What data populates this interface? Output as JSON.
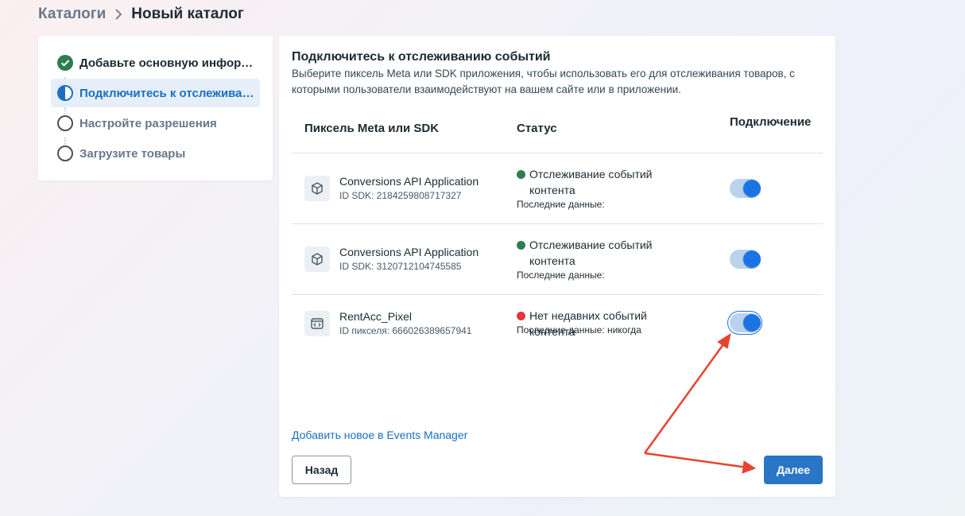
{
  "breadcrumb": {
    "parent": "Каталоги",
    "current": "Новый каталог"
  },
  "steps": [
    {
      "label": "Добавьте основную информацию",
      "state": "done"
    },
    {
      "label": "Подключитесь к отслеживанию событий",
      "state": "active"
    },
    {
      "label": "Настройте разрешения",
      "state": "pending"
    },
    {
      "label": "Загрузите товары",
      "state": "pending"
    }
  ],
  "main": {
    "title": "Подключитесь к отслеживанию событий",
    "description": "Выберите пиксель Meta или SDK приложения, чтобы использовать его для отслеживания товаров, с которыми пользователи взаимодействуют на вашем сайте или в приложении.",
    "table": {
      "headers": {
        "source": "Пиксель Meta или SDK",
        "status": "Статус",
        "connection": "Подключение"
      },
      "rows": [
        {
          "name": "Conversions API Application",
          "id": "ID SDK: 2184259808717327",
          "icon": "cube-icon",
          "status": "Отслеживание событий контента",
          "status_color": "#31a24c",
          "last_data": "Последние данные:",
          "connected": true
        },
        {
          "name": "Conversions API Application",
          "id": "ID SDK: 3120712104745585",
          "icon": "cube-icon",
          "status": "Отслеживание событий контента",
          "status_color": "#31a24c",
          "last_data": "Последние данные:",
          "connected": true
        },
        {
          "name": "RentAcc_Pixel",
          "id": "ID пикселя: 666026389657941",
          "icon": "code-window-icon",
          "status": "Нет недавних событий контента",
          "status_color": "#e41e3f",
          "last_data": "Последние данные: никогда",
          "connected": true
        }
      ]
    },
    "add_link": "Добавить новое в Events Manager",
    "back_label": "Назад",
    "next_label": "Далее"
  },
  "colors": {
    "accent": "#1b74e4",
    "annotation": "#e8432f"
  }
}
